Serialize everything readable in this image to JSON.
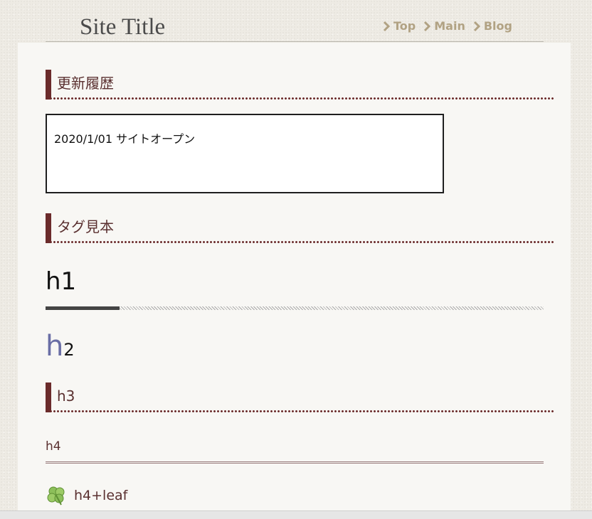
{
  "header": {
    "site_title": "Site Title",
    "nav": [
      {
        "label": "Top",
        "icon": "chevron-right-icon"
      },
      {
        "label": "Main",
        "icon": "chevron-right-icon"
      },
      {
        "label": "Blog",
        "icon": "chevron-right-icon"
      }
    ]
  },
  "sections": {
    "updates_heading": "更新履歴",
    "updates_entry": "2020/1/01 サイトオープン",
    "tags_heading": "タグ見本"
  },
  "samples": {
    "h1": "h1",
    "h2_first": "h",
    "h2_rest": "2",
    "h3": "h3",
    "h4": "h4",
    "h4_leaf": "h4+leaf",
    "leaf_icon": "clover-leaf-icon"
  },
  "colors": {
    "nav": "#b1a283",
    "accent": "#6b2b2b",
    "heading_text": "#5a3030",
    "h2_initial": "#6a6ea5"
  }
}
